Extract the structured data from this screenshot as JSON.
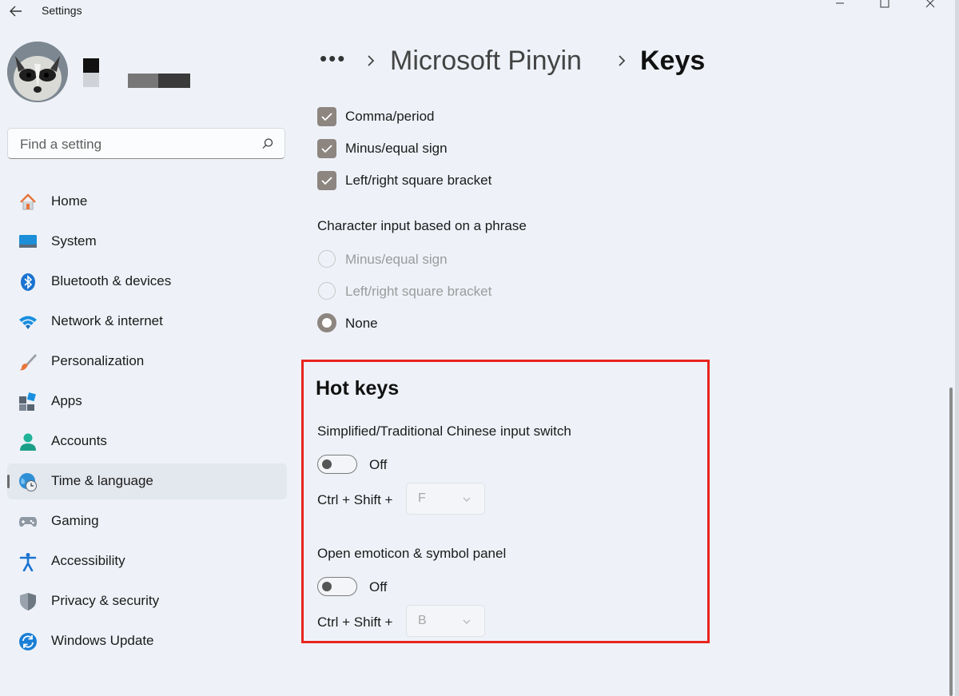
{
  "window": {
    "title": "Settings"
  },
  "search": {
    "placeholder": "Find a setting"
  },
  "nav": {
    "items": [
      {
        "label": "Home",
        "icon": "home-icon"
      },
      {
        "label": "System",
        "icon": "system-icon"
      },
      {
        "label": "Bluetooth & devices",
        "icon": "bluetooth-icon"
      },
      {
        "label": "Network & internet",
        "icon": "wifi-icon"
      },
      {
        "label": "Personalization",
        "icon": "brush-icon"
      },
      {
        "label": "Apps",
        "icon": "apps-icon"
      },
      {
        "label": "Accounts",
        "icon": "person-icon"
      },
      {
        "label": "Time & language",
        "icon": "globe-clock-icon",
        "active": true
      },
      {
        "label": "Gaming",
        "icon": "gamepad-icon"
      },
      {
        "label": "Accessibility",
        "icon": "accessibility-icon"
      },
      {
        "label": "Privacy & security",
        "icon": "shield-icon"
      },
      {
        "label": "Windows Update",
        "icon": "update-icon"
      }
    ]
  },
  "breadcrumb": {
    "more": "•••",
    "parent": "Microsoft Pinyin",
    "current": "Keys"
  },
  "content": {
    "checkbox_options": [
      {
        "label": "Comma/period",
        "checked": true
      },
      {
        "label": "Minus/equal sign",
        "checked": true
      },
      {
        "label": "Left/right square bracket",
        "checked": true
      }
    ],
    "phrase_section": {
      "label": "Character input based on a phrase",
      "options": [
        {
          "label": "Minus/equal sign",
          "selected": false,
          "disabled": true
        },
        {
          "label": "Left/right square bracket",
          "selected": false,
          "disabled": true
        },
        {
          "label": "None",
          "selected": true,
          "disabled": false
        }
      ]
    },
    "hot_keys": {
      "title": "Hot keys",
      "items": [
        {
          "label": "Simplified/Traditional Chinese input switch",
          "toggle_state": "Off",
          "combo": "Ctrl + Shift +",
          "key": "F"
        },
        {
          "label": "Open emoticon & symbol panel",
          "toggle_state": "Off",
          "combo": "Ctrl + Shift +",
          "key": "B"
        }
      ]
    }
  },
  "colors": {
    "highlight_border": "#e8251f",
    "checkbox_fill": "#8d8580",
    "background": "#eef2f8"
  }
}
